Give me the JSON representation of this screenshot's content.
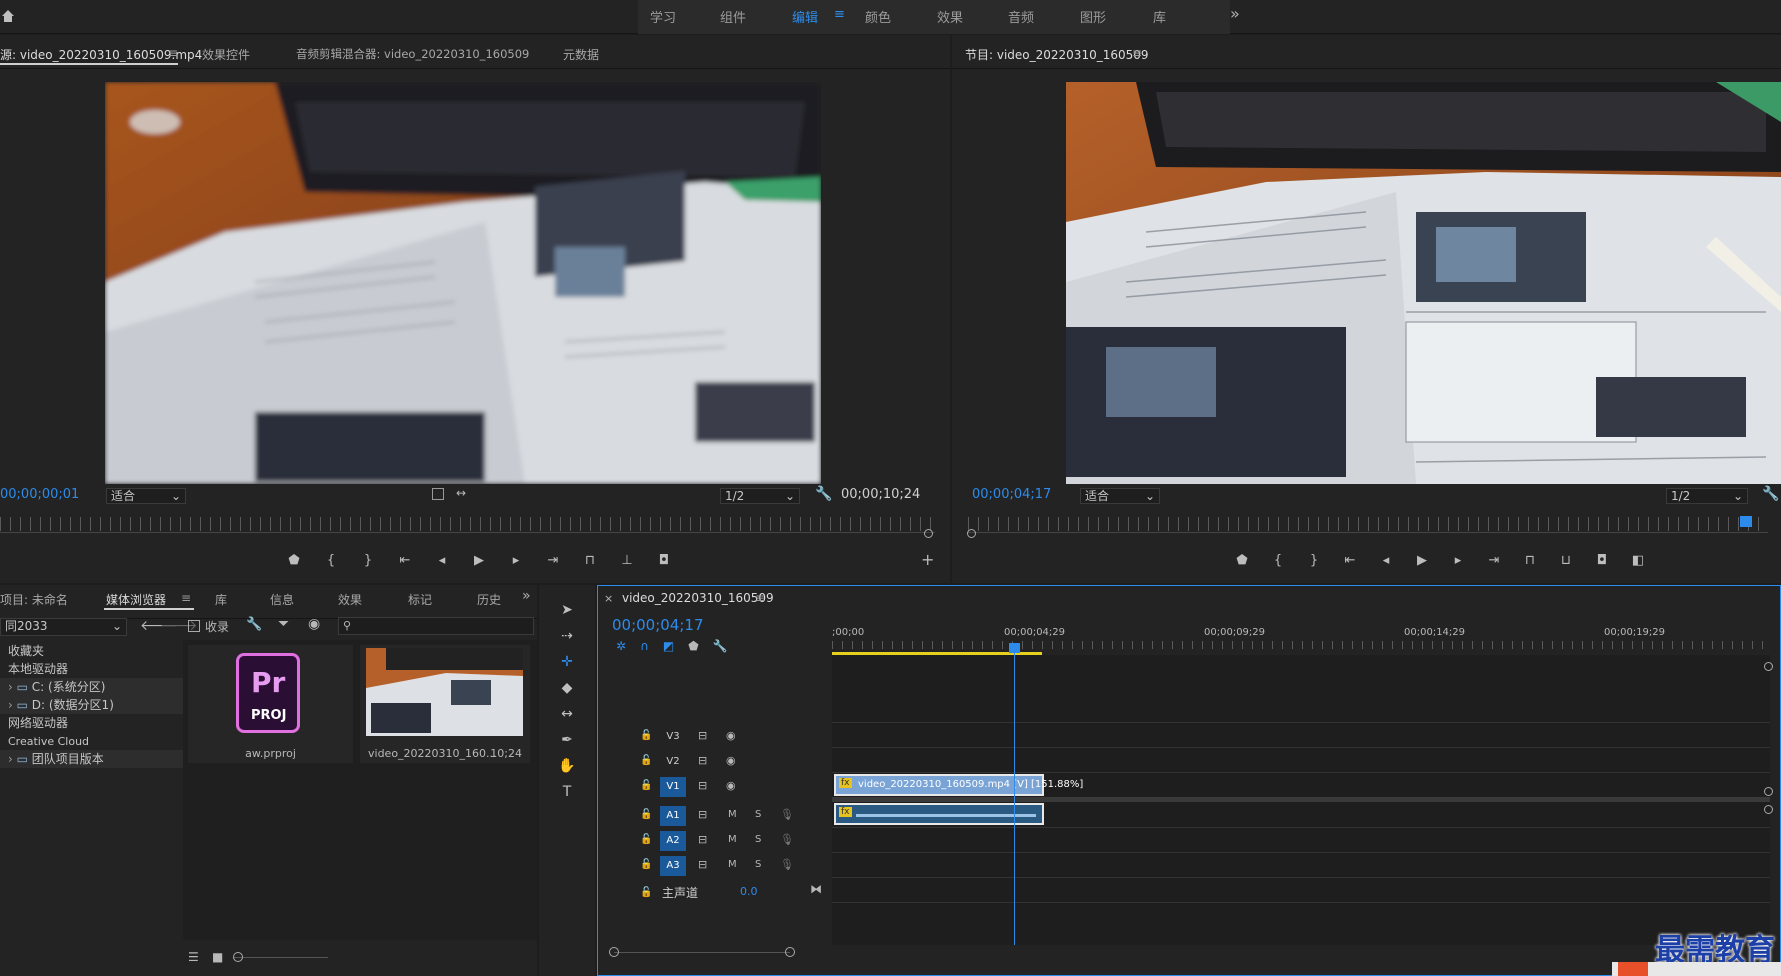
{
  "workspaces": [
    "学习",
    "组件",
    "编辑",
    "颜色",
    "效果",
    "音频",
    "图形",
    "库"
  ],
  "active_workspace": "编辑",
  "overflow": "»",
  "source": {
    "tabs": [
      "源: video_20220310_160509.mp4",
      "效果控件",
      "音频剪辑混合器: video_20220310_160509",
      "元数据"
    ],
    "menu": "≡",
    "timecode_in": "00;00;00;01",
    "fit": "适合",
    "resolution": "1/2",
    "timecode_out": "00;00;10;24"
  },
  "program": {
    "tab": "节目: video_20220310_160509",
    "menu": "≡",
    "timecode": "00;00;04;17",
    "fit": "适合",
    "resolution": "1/2"
  },
  "project": {
    "tabs": [
      "项目: 未命名",
      "媒体浏览器",
      "库",
      "信息",
      "效果",
      "标记",
      "历史"
    ],
    "menu": "≡",
    "overflow": "»",
    "drive": "同2033",
    "ingest_label": "收录",
    "tree": [
      {
        "label": "收藏夹",
        "indent": 0
      },
      {
        "label": "本地驱动器",
        "indent": 0
      },
      {
        "label": "C: (系统分区)",
        "indent": 1,
        "sel": true
      },
      {
        "label": "D: (数据分区1)",
        "indent": 1,
        "sel": true
      },
      {
        "label": "网络驱动器",
        "indent": 0
      },
      {
        "label": "Creative Cloud",
        "indent": 0
      },
      {
        "label": "团队项目版本",
        "indent": 1,
        "sel": true
      }
    ],
    "thumb1_label": "aw.prproj",
    "pr_text": "Pr",
    "proj_text": "PROJ",
    "thumb2_label": "video_20220310_160...",
    "thumb2_dur": "10;24"
  },
  "timeline": {
    "close": "×",
    "tab": "video_20220310_160509",
    "menu": "≡",
    "timecode": "00;00;04;17",
    "ruler": [
      ";00;00",
      "00;00;04;29",
      "00;00;09;29",
      "00;00;14;29",
      "00;00;19;29"
    ],
    "video_tracks": [
      "V3",
      "V2",
      "V1"
    ],
    "audio_tracks": [
      "A1",
      "A2",
      "A3"
    ],
    "master_label": "主声道",
    "master_value": "0.0",
    "clip_label": "video_20220310_160509.mp4 [V] [151.88%]",
    "fx": "fx",
    "m": "M",
    "s": "S"
  },
  "watermark": "最需教育"
}
